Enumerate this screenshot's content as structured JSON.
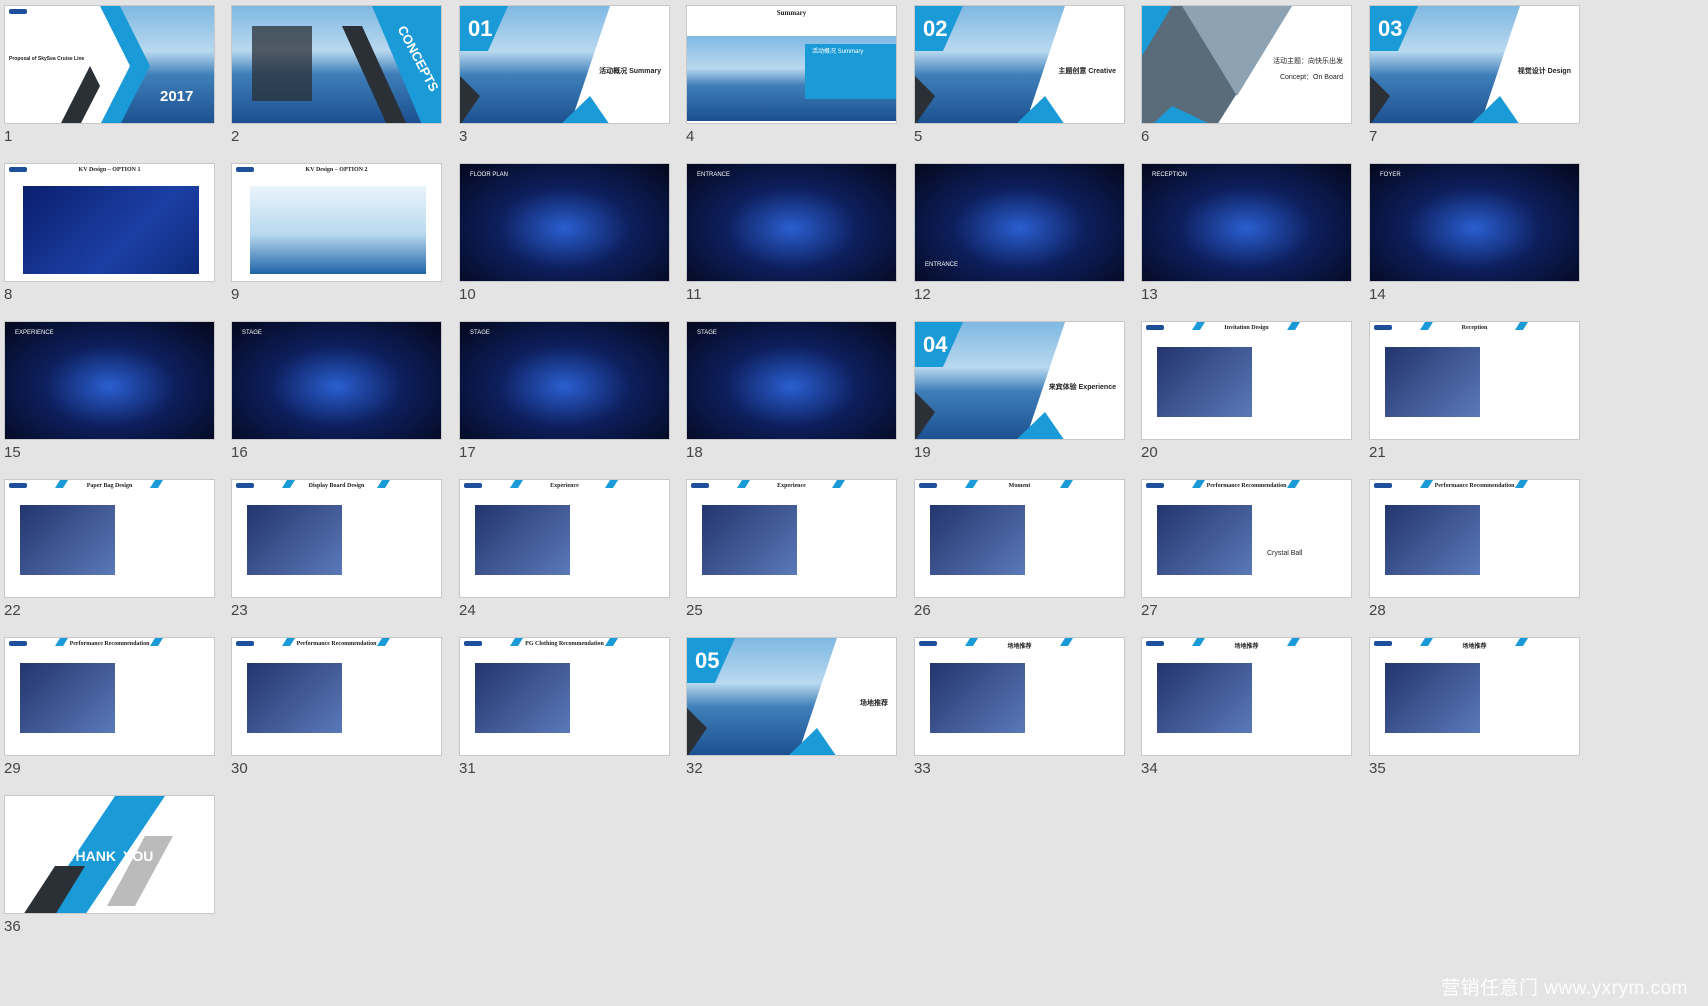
{
  "slides": [
    {
      "num": "1",
      "texts": [
        "Proposal of SkySea Cruise Line",
        "2017"
      ]
    },
    {
      "num": "2",
      "texts": [
        "CONCEPTS"
      ]
    },
    {
      "num": "3",
      "badge": "01",
      "texts": [
        "活动概况 Summary"
      ]
    },
    {
      "num": "4",
      "texts": [
        "Summary",
        "活动概况 Summary"
      ]
    },
    {
      "num": "5",
      "badge": "02",
      "texts": [
        "主题创意 Creative"
      ]
    },
    {
      "num": "6",
      "texts": [
        "活动主题：向快乐出发",
        "Concept：On Board"
      ]
    },
    {
      "num": "7",
      "badge": "03",
      "texts": [
        "视觉设计 Design"
      ]
    },
    {
      "num": "8",
      "texts": [
        "KV Design – OPTION 1"
      ]
    },
    {
      "num": "9",
      "texts": [
        "KV Design – OPTION 2"
      ]
    },
    {
      "num": "10",
      "texts": [
        "FLOOR PLAN"
      ]
    },
    {
      "num": "11",
      "texts": [
        "ENTRANCE"
      ]
    },
    {
      "num": "12",
      "texts": [
        "ENTRANCE"
      ]
    },
    {
      "num": "13",
      "texts": [
        "RECEPTION"
      ]
    },
    {
      "num": "14",
      "texts": [
        "FOYER"
      ]
    },
    {
      "num": "15",
      "texts": [
        "EXPERIENCE"
      ]
    },
    {
      "num": "16",
      "texts": [
        "STAGE"
      ]
    },
    {
      "num": "17",
      "texts": [
        "STAGE"
      ]
    },
    {
      "num": "18",
      "texts": [
        "STAGE"
      ]
    },
    {
      "num": "19",
      "badge": "04",
      "texts": [
        "来宾体验 Experience"
      ]
    },
    {
      "num": "20",
      "texts": [
        "Invitation Design"
      ]
    },
    {
      "num": "21",
      "texts": [
        "Reception"
      ]
    },
    {
      "num": "22",
      "texts": [
        "Paper Bag Design"
      ]
    },
    {
      "num": "23",
      "texts": [
        "Display Board Design"
      ]
    },
    {
      "num": "24",
      "texts": [
        "Experience"
      ]
    },
    {
      "num": "25",
      "texts": [
        "Experience"
      ]
    },
    {
      "num": "26",
      "texts": [
        "Moment"
      ]
    },
    {
      "num": "27",
      "texts": [
        "Performance Recommendation",
        "Crystal Ball"
      ]
    },
    {
      "num": "28",
      "texts": [
        "Performance Recommendation"
      ]
    },
    {
      "num": "29",
      "texts": [
        "Performance Recommendation"
      ]
    },
    {
      "num": "30",
      "texts": [
        "Performance Recommendation"
      ]
    },
    {
      "num": "31",
      "texts": [
        "PG Clothing Recommendation"
      ]
    },
    {
      "num": "32",
      "badge": "05",
      "texts": [
        "场地推荐"
      ]
    },
    {
      "num": "33",
      "texts": [
        "场地推荐"
      ]
    },
    {
      "num": "34",
      "texts": [
        "场地推荐"
      ]
    },
    {
      "num": "35",
      "texts": [
        "场地推荐"
      ]
    },
    {
      "num": "36",
      "texts": [
        "THANK",
        "YOU"
      ]
    }
  ],
  "watermark": "营销任意门 www.yxrym.com",
  "colors": {
    "accent": "#1a9ad6",
    "dark": "#2b2f36",
    "background": "#e4e4e4",
    "navy": "#0b1a5a"
  }
}
